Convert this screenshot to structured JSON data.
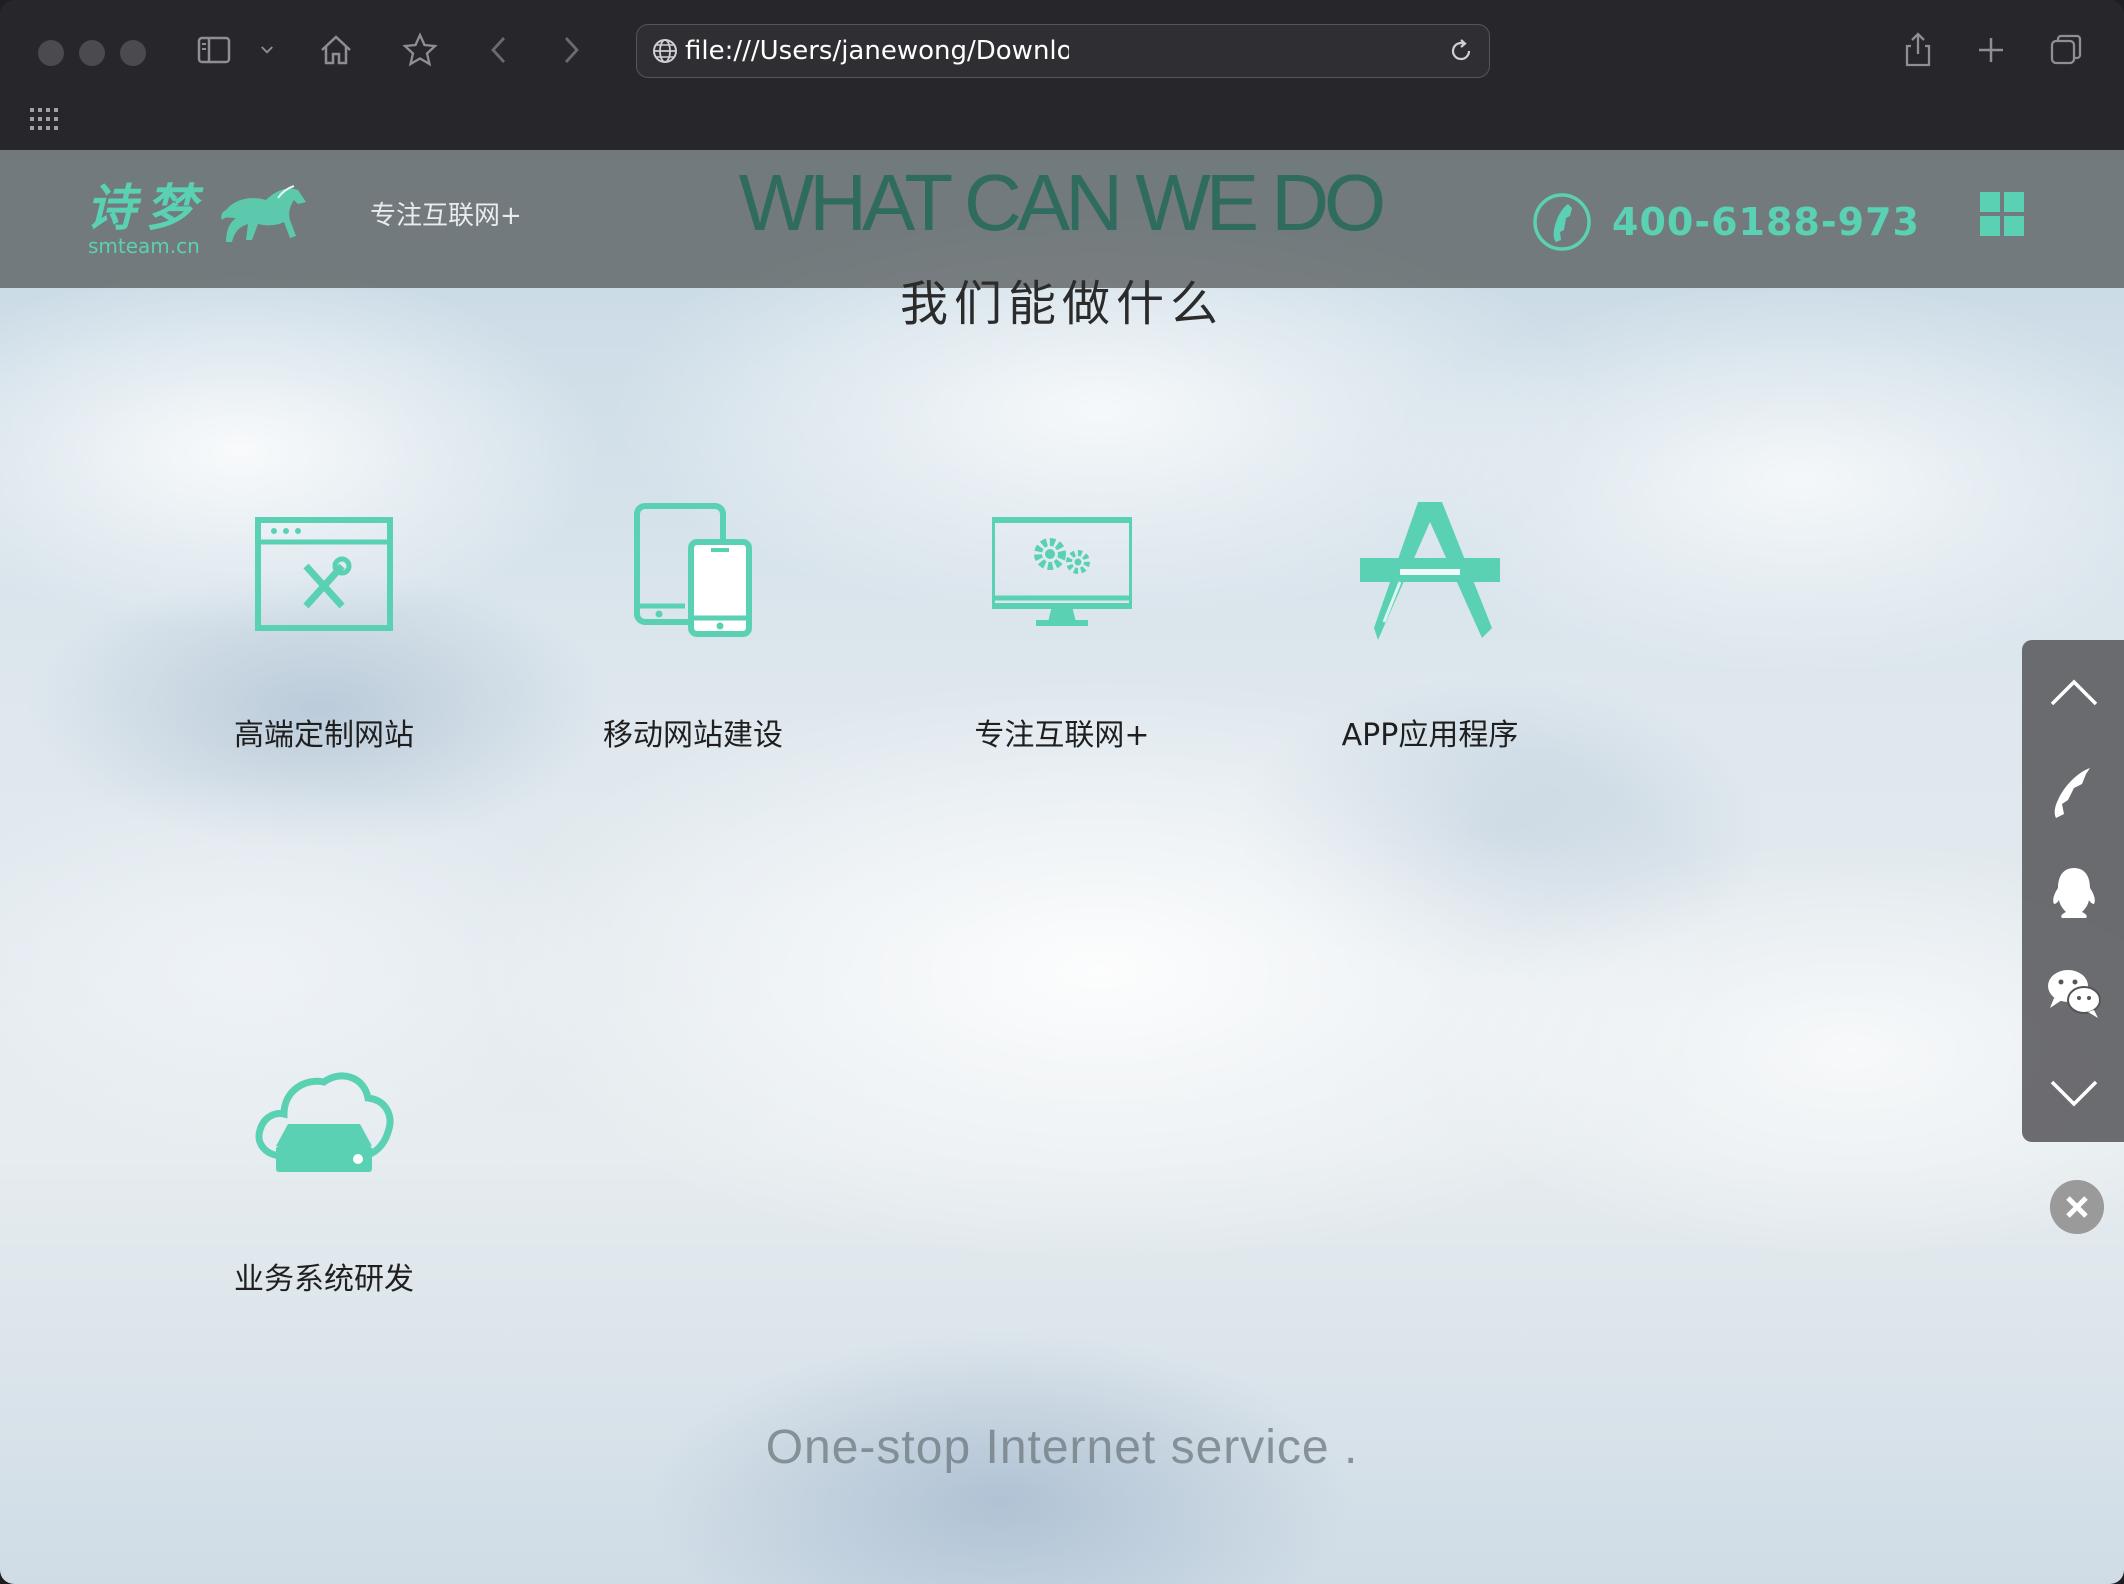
{
  "browser": {
    "url": "file:///Users/janewong/Downloads/好看大气的建站官网单页源码"
  },
  "header": {
    "logo_cn": "诗梦",
    "logo_en": "smteam.cn",
    "slogan": "专注互联网+",
    "watermark": "WHAT CAN WE DO",
    "phone": "400-6188-973"
  },
  "main": {
    "title": "我们能做什么",
    "services": [
      {
        "label": "高端定制网站",
        "icon": "website-tools-icon"
      },
      {
        "label": "移动网站建设",
        "icon": "mobile-devices-icon"
      },
      {
        "label": "专注互联网+",
        "icon": "monitor-gears-icon"
      },
      {
        "label": "APP应用程序",
        "icon": "app-store-icon"
      },
      {
        "label": "业务系统研发",
        "icon": "cloud-server-icon"
      }
    ],
    "tagline": "One-stop Internet service ."
  },
  "colors": {
    "accent": "#5ad1b3",
    "header_bg": "#505454",
    "chrome_bg": "#26262b",
    "sidebar_bg": "#555558"
  },
  "sidebar": {
    "items": [
      "chevron-up-icon",
      "phone-icon",
      "qq-icon",
      "wechat-icon",
      "chevron-down-icon"
    ]
  }
}
